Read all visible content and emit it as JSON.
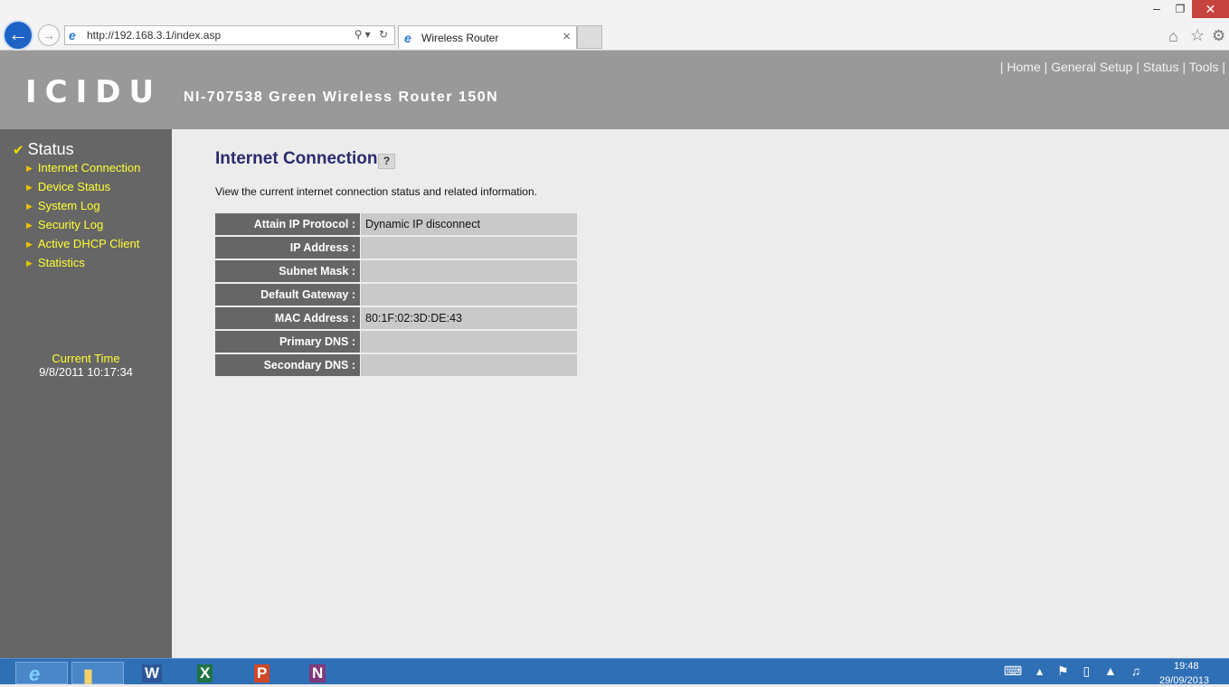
{
  "browser": {
    "url": "http://192.168.3.1/index.asp",
    "tab_title": "Wireless Router"
  },
  "header": {
    "logo": "ICIDU",
    "model": "NI-707538 Green Wireless Router 150N",
    "nav": [
      "Home",
      "General Setup",
      "Status",
      "Tools"
    ]
  },
  "sidebar": {
    "title": "Status",
    "items": [
      {
        "label": "Internet Connection"
      },
      {
        "label": "Device Status"
      },
      {
        "label": "System Log"
      },
      {
        "label": "Security Log"
      },
      {
        "label": "Active DHCP Client"
      },
      {
        "label": "Statistics"
      }
    ],
    "time_label": "Current Time",
    "time_value": "9/8/2011 10:17:34"
  },
  "main": {
    "title": "Internet Connection",
    "description": "View the current internet connection status and related information.",
    "rows": [
      {
        "label": "Attain IP Protocol :",
        "value": "Dynamic IP disconnect"
      },
      {
        "label": "IP Address :",
        "value": ""
      },
      {
        "label": "Subnet Mask :",
        "value": ""
      },
      {
        "label": "Default Gateway :",
        "value": ""
      },
      {
        "label": "MAC Address :",
        "value": "80:1F:02:3D:DE:43"
      },
      {
        "label": "Primary DNS :",
        "value": ""
      },
      {
        "label": "Secondary DNS :",
        "value": ""
      }
    ]
  },
  "taskbar": {
    "apps": [
      "internet-explorer",
      "file-explorer",
      "word",
      "excel",
      "powerpoint",
      "onenote"
    ],
    "clock_time": "19:48",
    "clock_date": "29/09/2013"
  }
}
